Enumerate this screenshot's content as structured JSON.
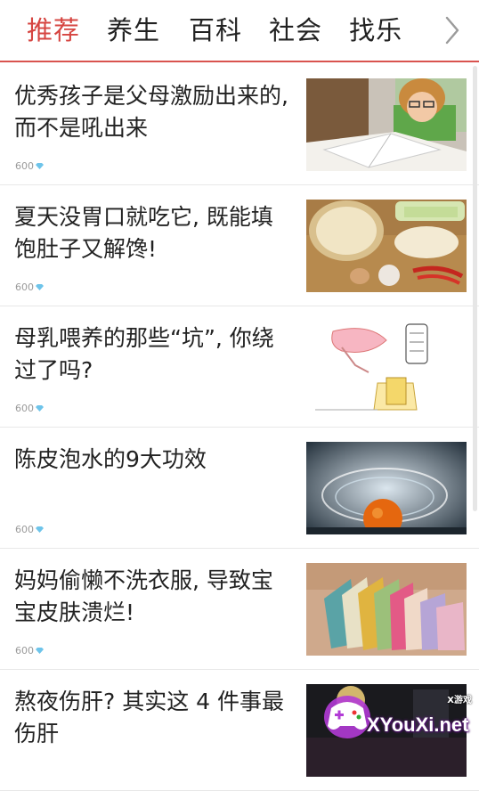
{
  "tabs": [
    {
      "label": "推荐",
      "active": true
    },
    {
      "label": "养生",
      "active": false
    },
    {
      "label": "百科",
      "active": false
    },
    {
      "label": "社会",
      "active": false
    },
    {
      "label": "找乐",
      "active": false
    }
  ],
  "more_icon": "chevron-right-icon",
  "accent_color": "#d64541",
  "articles": [
    {
      "title": "优秀孩子是父母激励出来的, 而不是吼出来",
      "views": "600",
      "views_icon": "diamond-icon",
      "image": "child-reading-book"
    },
    {
      "title": "夏天没胃口就吃它, 既能填饱肚子又解馋!",
      "views": "600",
      "views_icon": "diamond-icon",
      "image": "noodles-and-vegetables"
    },
    {
      "title": "母乳喂养的那些“坑”, 你绕过了吗?",
      "views": "600",
      "views_icon": "diamond-icon",
      "image": "cartoon-illustration"
    },
    {
      "title": "陈皮泡水的9大功效",
      "views": "600",
      "views_icon": "diamond-icon",
      "image": "orange-in-water"
    },
    {
      "title": "妈妈偷懒不洗衣服, 导致宝宝皮肤溃烂!",
      "views": "600",
      "views_icon": "diamond-icon",
      "image": "folded-clothes"
    },
    {
      "title": "熬夜伤肝? 其实这 4 件事最伤肝",
      "views": "",
      "views_icon": "",
      "image": "night-scene"
    }
  ],
  "watermark": {
    "site": "XYouXi.net",
    "small": "X游戏"
  }
}
